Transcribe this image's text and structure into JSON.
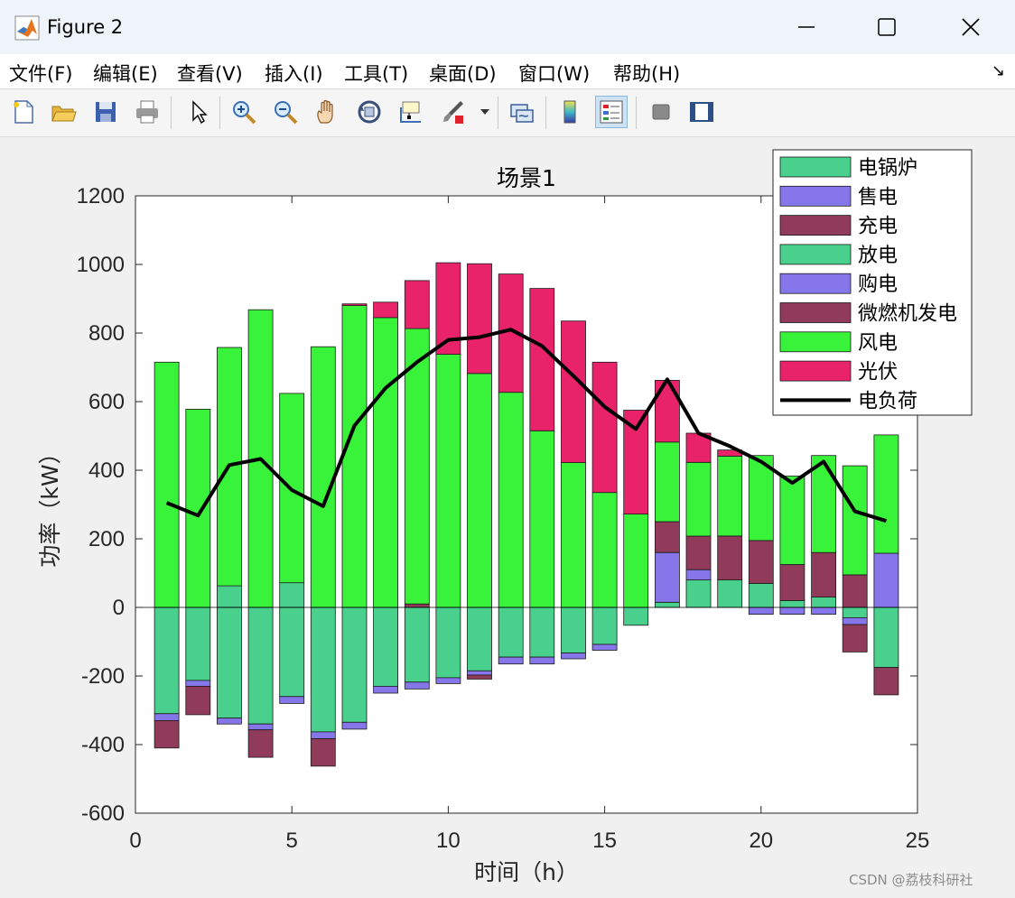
{
  "window": {
    "title": "Figure 2"
  },
  "menu": [
    "文件(F)",
    "编辑(E)",
    "查看(V)",
    "插入(I)",
    "工具(T)",
    "桌面(D)",
    "窗口(W)",
    "帮助(H)"
  ],
  "toolbar_icons": [
    "new-figure-icon",
    "open-file-icon",
    "save-icon",
    "print-icon",
    "pointer-icon",
    "zoom-in-icon",
    "zoom-out-icon",
    "pan-hand-icon",
    "rotate-3d-icon",
    "data-cursor-icon",
    "brush-icon",
    "brush-dropdown-icon",
    "link-plot-icon",
    "colorbar-icon",
    "legend-icon",
    "hide-plot-tools-icon",
    "show-plot-tools-icon"
  ],
  "watermark": "CSDN @荔枝科研社",
  "colors": {
    "电锅炉": "#48d08c",
    "售电": "#8577ea",
    "充电": "#8f3b59",
    "放电": "#48d08c",
    "购电": "#8577ea",
    "微燃机发电": "#8f3b59",
    "风电": "#39f33b",
    "光伏": "#e8236a",
    "电负荷": "#000000"
  },
  "chart_data": {
    "type": "bar",
    "stacked": true,
    "title": "场景1",
    "xlabel": "时间（h）",
    "ylabel": "功率（kW）",
    "xlim": [
      0,
      25
    ],
    "ylim": [
      -600,
      1200
    ],
    "xticks": [
      "0",
      "5",
      "10",
      "15",
      "20",
      "25"
    ],
    "yticks": [
      "-600",
      "-400",
      "-200",
      "0",
      "200",
      "400",
      "600",
      "800",
      "1000",
      "1200"
    ],
    "grid": false,
    "legend_position": "top-right",
    "x": [
      1,
      2,
      3,
      4,
      5,
      6,
      7,
      8,
      9,
      10,
      11,
      12,
      13,
      14,
      15,
      16,
      17,
      18,
      19,
      20,
      21,
      22,
      23,
      24
    ],
    "series": [
      {
        "name": "电锅炉",
        "values": [
          -310,
          -213,
          -323,
          -340,
          -260,
          -363,
          -335,
          -230,
          -218,
          -205,
          -185,
          -145,
          -145,
          -133,
          -108,
          0,
          0,
          0,
          0,
          0,
          0,
          0,
          -30,
          -175
        ]
      },
      {
        "name": "售电",
        "values": [
          -20,
          -17,
          -17,
          -17,
          -20,
          -20,
          -20,
          -20,
          -20,
          -17,
          -12,
          -20,
          -20,
          -17,
          -17,
          0,
          0,
          0,
          0,
          -20,
          -20,
          -20,
          -20,
          0
        ]
      },
      {
        "name": "充电",
        "values": [
          -80,
          -83,
          0,
          -80,
          0,
          -80,
          0,
          0,
          0,
          0,
          -12,
          0,
          0,
          0,
          0,
          0,
          0,
          0,
          0,
          0,
          0,
          0,
          -80,
          -80
        ]
      },
      {
        "name": "放电",
        "values": [
          0,
          0,
          63,
          0,
          72,
          0,
          0,
          0,
          0,
          0,
          0,
          0,
          0,
          0,
          0,
          -52,
          15,
          80,
          80,
          70,
          20,
          30,
          0,
          0
        ]
      },
      {
        "name": "购电",
        "values": [
          0,
          0,
          0,
          0,
          0,
          0,
          0,
          0,
          0,
          0,
          0,
          0,
          0,
          0,
          0,
          0,
          145,
          30,
          0,
          0,
          0,
          0,
          0,
          158
        ]
      },
      {
        "name": "微燃机发电",
        "values": [
          0,
          0,
          0,
          0,
          0,
          0,
          0,
          0,
          10,
          0,
          0,
          0,
          0,
          0,
          0,
          0,
          90,
          98,
          128,
          125,
          105,
          130,
          95,
          0
        ]
      },
      {
        "name": "风电",
        "values": [
          715,
          578,
          695,
          868,
          552,
          760,
          880,
          845,
          803,
          738,
          682,
          627,
          515,
          422,
          335,
          272,
          232,
          215,
          233,
          248,
          258,
          283,
          318,
          345
        ]
      },
      {
        "name": "光伏",
        "values": [
          0,
          0,
          0,
          0,
          0,
          0,
          5,
          45,
          140,
          267,
          320,
          345,
          415,
          413,
          380,
          303,
          180,
          85,
          18,
          0,
          0,
          0,
          0,
          0
        ]
      },
      {
        "name": "电负荷",
        "type": "line",
        "values": [
          305,
          268,
          415,
          433,
          342,
          295,
          530,
          640,
          715,
          780,
          788,
          810,
          762,
          675,
          585,
          520,
          665,
          508,
          470,
          425,
          363,
          425,
          280,
          252
        ]
      }
    ]
  }
}
